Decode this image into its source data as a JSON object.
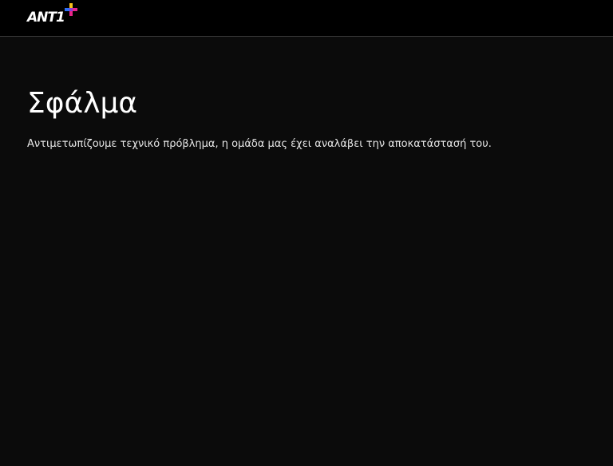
{
  "header": {
    "logo_text": "ANT1",
    "logo_icon": "plus-icon",
    "colors": {
      "background": "#000000",
      "plus_blue": "#2f6ff5",
      "plus_magenta": "#e8248a",
      "plus_yellow": "#f7c21b",
      "plus_purple": "#8a3ad6"
    }
  },
  "main": {
    "title": "Σφάλμα",
    "message": "Αντιμετωπίζουμε τεχνικό πρόβλημα, η ομάδα μας έχει αναλάβει την αποκατάστασή του."
  }
}
